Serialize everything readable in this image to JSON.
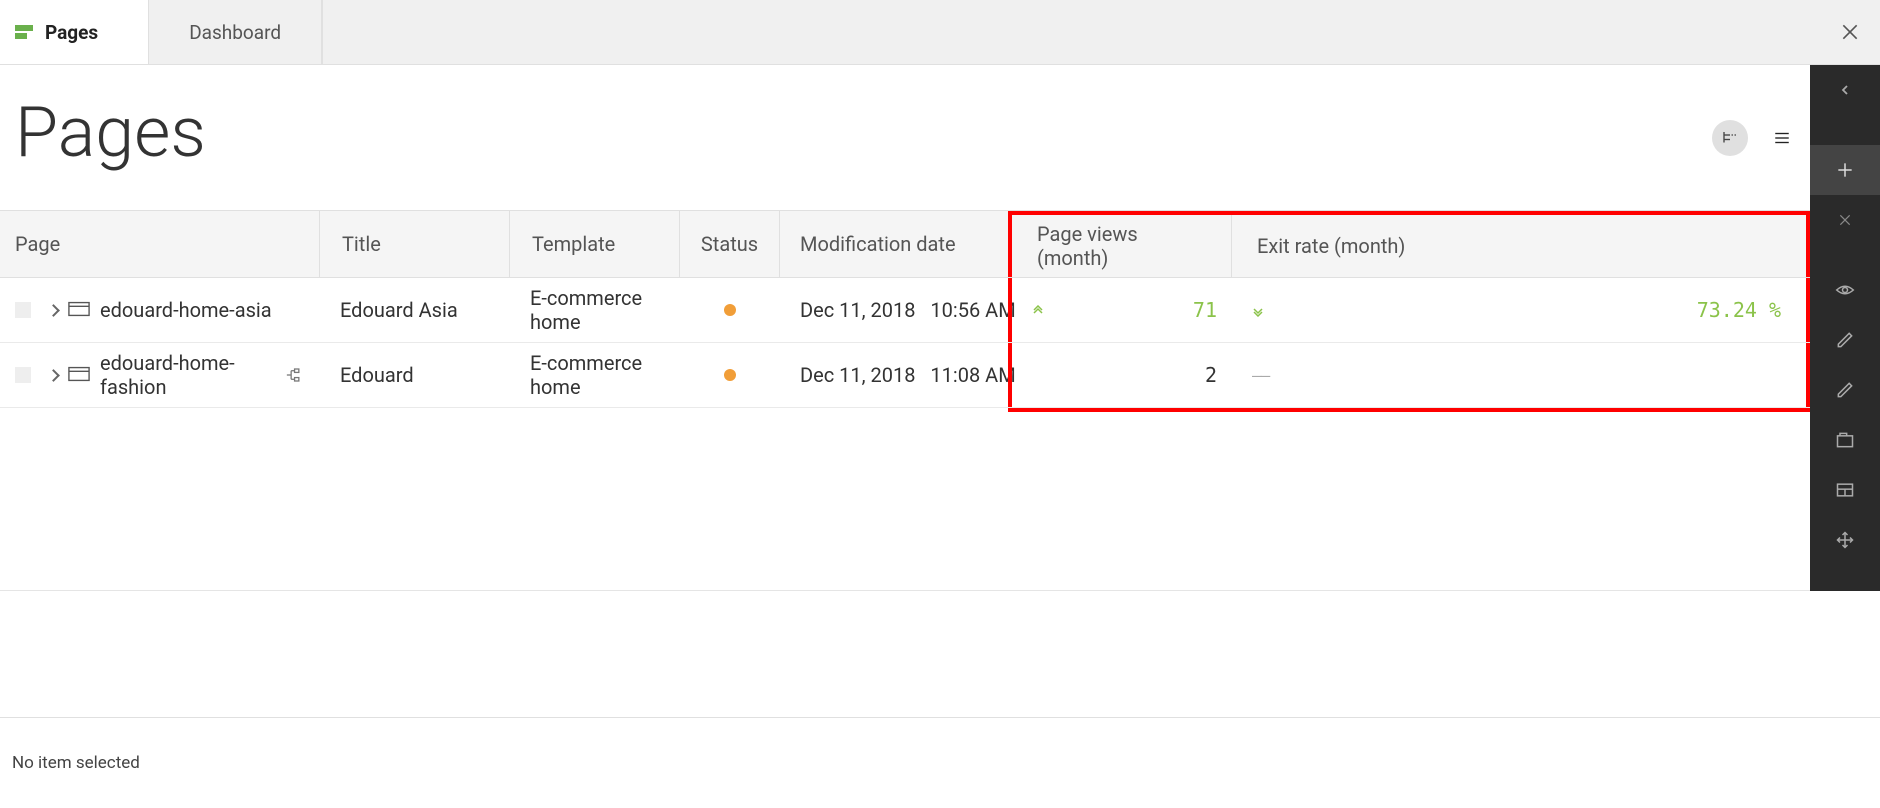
{
  "tabs": {
    "pages": "Pages",
    "dashboard": "Dashboard"
  },
  "header": {
    "title": "Pages"
  },
  "columns": {
    "page": "Page",
    "title": "Title",
    "template": "Template",
    "status": "Status",
    "mod": "Modification date",
    "views": "Page views (month)",
    "exit": "Exit rate (month)"
  },
  "rows": [
    {
      "page": "edouard-home-asia",
      "title": "Edouard Asia",
      "template": "E-commerce home",
      "status": "modified",
      "mod": "Dec 11, 2018   10:56 AM",
      "views": "71",
      "views_trend": "up",
      "exit": "73.24 %",
      "exit_trend": "down",
      "has_variant": false
    },
    {
      "page": "edouard-home-fashion",
      "title": "Edouard",
      "template": "E-commerce home",
      "status": "modified",
      "mod": "Dec 11, 2018   11:08 AM",
      "views": "2",
      "views_trend": "none",
      "exit": "",
      "exit_trend": "dash",
      "has_variant": true
    }
  ],
  "footer": {
    "no_selection": "No item selected"
  }
}
